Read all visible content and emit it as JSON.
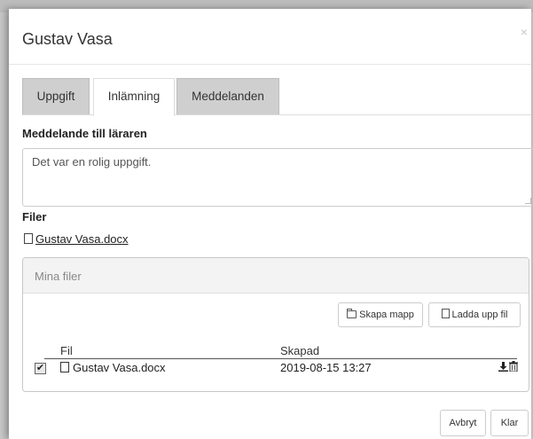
{
  "modal": {
    "title": "Gustav Vasa",
    "close_glyph": "×"
  },
  "tabs": [
    {
      "label": "Uppgift"
    },
    {
      "label": "Inlämning"
    },
    {
      "label": "Meddelanden"
    }
  ],
  "message": {
    "label": "Meddelande till läraren",
    "value": "Det var en rolig uppgift."
  },
  "files": {
    "label": "Filer",
    "link": "Gustav Vasa.docx"
  },
  "panel": {
    "title": "Mina filer",
    "create_folder_label": "Skapa mapp",
    "upload_label": "Ladda upp fil",
    "columns": {
      "file": "Fil",
      "created": "Skapad"
    },
    "rows": [
      {
        "name": "Gustav Vasa.docx",
        "created": "2019-08-15 13:27",
        "checked": true
      }
    ]
  },
  "footer": {
    "cancel_label": "Avbryt",
    "done_label": "Klar"
  },
  "icons": {
    "doc": "document-icon",
    "folder": "folder-icon",
    "download": "download-icon",
    "trash": "trash-icon",
    "check": "✔"
  }
}
